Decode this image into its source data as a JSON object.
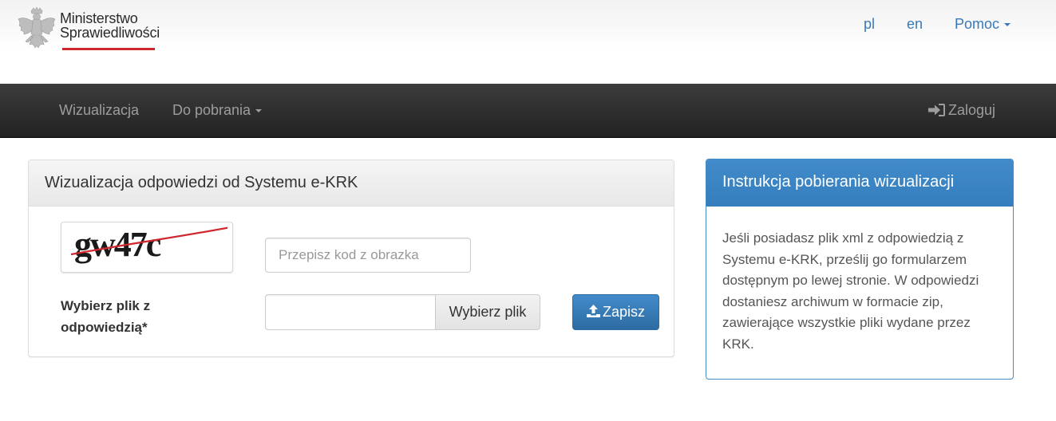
{
  "header": {
    "logo": {
      "line1": "Ministerstwo",
      "line2": "Sprawiedliwości"
    },
    "lang_pl": "pl",
    "lang_en": "en",
    "help_label": "Pomoc"
  },
  "navbar": {
    "visualization_label": "Wizualizacja",
    "downloads_label": "Do pobrania",
    "login_label": "Zaloguj"
  },
  "form_panel": {
    "title": "Wizualizacja odpowiedzi od Systemu e-KRK",
    "captcha_text": "gw47c",
    "captcha_placeholder": "Przepisz kod z obrazka",
    "file_label": "Wybierz plik z odpowiedzią*",
    "file_value": "",
    "choose_file_label": "Wybierz plik",
    "save_label": "Zapisz"
  },
  "info_panel": {
    "title": "Instrukcja pobierania wizualizacji",
    "body": "Jeśli posiadasz plik xml z odpowiedzią z Systemu e-KRK, prześlij go formularzem dostępnym po lewej stronie. W odpowiedzi dostaniesz archiwum w formacie zip, zawierające wszystkie pliki wydane przez KRK."
  },
  "colors": {
    "primary": "#428bca",
    "link": "#3a78b8",
    "navbar": "#2a2a2a",
    "logo_red": "#d0262e"
  },
  "icons": {
    "logo": "polish-eagle-emblem",
    "login": "sign-in-icon",
    "save": "upload-icon",
    "dropdown": "caret-down-icon"
  }
}
